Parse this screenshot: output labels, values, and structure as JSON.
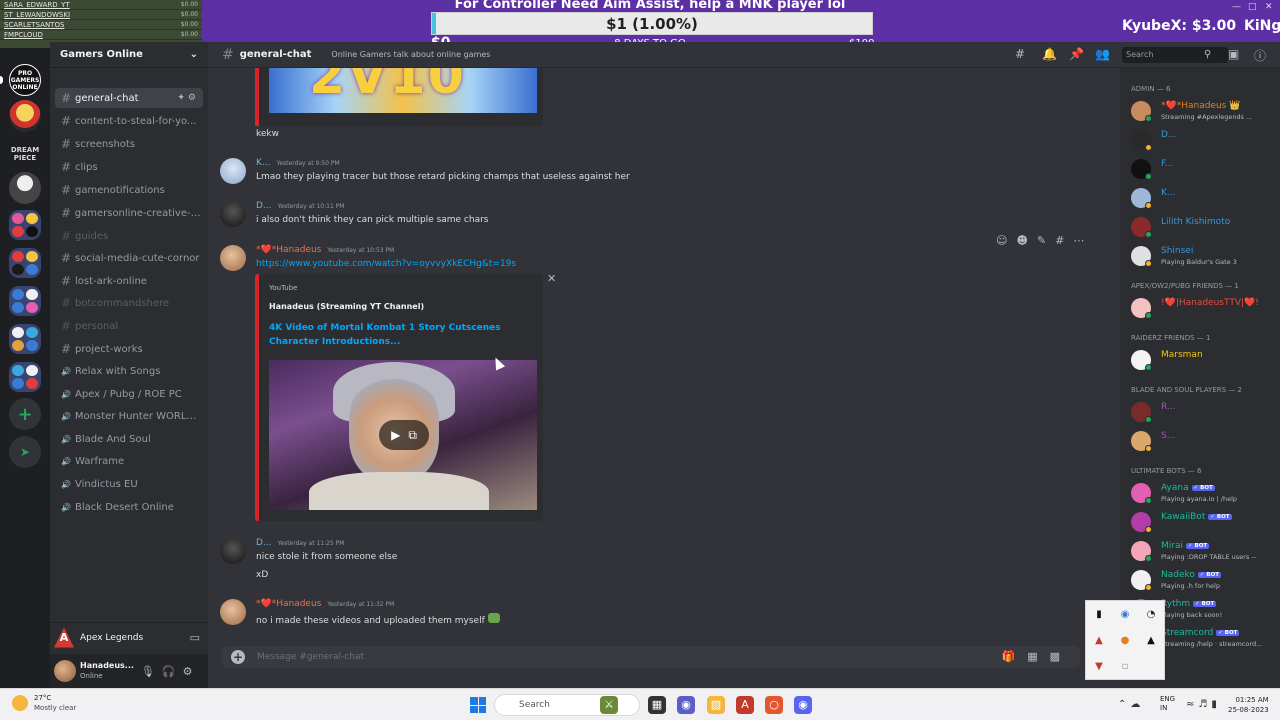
{
  "overlay": {
    "recent_list": [
      {
        "name": "SARA_EDWARD_YT",
        "count": "$0.00"
      },
      {
        "name": "ST_LEWANDOWSKI",
        "count": "$0.00"
      },
      {
        "name": "SCARLETSANTOS",
        "count": "$0.00"
      },
      {
        "name": "FMPCLOUD",
        "count": "$0.00"
      }
    ],
    "title": "For Controller Need Aim Assist, help a MNK player lol",
    "goal_text": "$1 (1.00%)",
    "goal_progress": 0.01,
    "goal_min": "$0",
    "goal_days": "8 DAYS TO GO",
    "goal_max": "$100",
    "top_donor": "KyubeX: $3.00",
    "ticker": "KiNg"
  },
  "servers": {
    "home_label": "PRO GAMERS ONLINE",
    "dream_label": "DREAM PIECE",
    "add_label": "+",
    "explore_label": "➤"
  },
  "sidebar": {
    "server_name": "Gamers Online",
    "channels": [
      {
        "label": "general-chat",
        "type": "text",
        "active": true
      },
      {
        "label": "content-to-steal-for-yo...",
        "type": "text"
      },
      {
        "label": "screenshots",
        "type": "text"
      },
      {
        "label": "clips",
        "type": "text"
      },
      {
        "label": "gamenotifications",
        "type": "text"
      },
      {
        "label": "gamersonline-creative-s...",
        "type": "text"
      },
      {
        "label": "guides",
        "type": "text",
        "muted": true
      },
      {
        "label": "social-media-cute-cornor",
        "type": "text"
      },
      {
        "label": "lost-ark-online",
        "type": "text"
      },
      {
        "label": "botcommandshere",
        "type": "text",
        "muted": true
      },
      {
        "label": "personal",
        "type": "text",
        "muted": true
      },
      {
        "label": "project-works",
        "type": "text"
      },
      {
        "label": "Relax with Songs",
        "type": "voice"
      },
      {
        "label": "Apex / Pubg / ROE PC",
        "type": "voice"
      },
      {
        "label": "Monster Hunter WORLD...",
        "type": "voice"
      },
      {
        "label": "Blade And Soul",
        "type": "voice"
      },
      {
        "label": "Warframe",
        "type": "voice"
      },
      {
        "label": "Vindictus EU",
        "type": "voice"
      },
      {
        "label": "Black Desert Online",
        "type": "voice"
      }
    ],
    "activity": "Apex Legends",
    "user": {
      "name": "Hanadeus...",
      "status": "Online"
    }
  },
  "header": {
    "channel": "general-chat",
    "topic": "Online Gamers talk about online games",
    "search_placeholder": "Search"
  },
  "messages": [
    {
      "text": "kekw"
    },
    {
      "author": "K...",
      "time": "Yesterday at 9:50 PM",
      "text": "Lmao they playing tracer but those retard picking champs that useless against her"
    },
    {
      "author": "D...",
      "time": "Yesterday at 10:11 PM",
      "text": "i also don't think they can pick multiple same chars"
    },
    {
      "author": "*❤️*Hanadeus",
      "time": "Yesterday at 10:53 PM",
      "text": "https://www.youtube.com/watch?v=oyvvyXkECHg&t=19s"
    },
    {
      "author": "D...",
      "time": "Yesterday at 11:25 PM",
      "text": "nice stole it from someone else",
      "text2": "xD"
    },
    {
      "author": "*❤️*Hanadeus",
      "time": "Yesterday at 11:32 PM",
      "text": "no i made these videos and uploaded them myself"
    }
  ],
  "embed": {
    "provider": "YouTube",
    "author": "Hanadeus (Streaming YT Channel)",
    "title": "4K Video of Mortal Kombat 1 Story Cutscenes Character Introductions...",
    "top_image_text": "2V10"
  },
  "composer": {
    "placeholder": "Message #general-chat"
  },
  "members": {
    "categories": [
      {
        "label": "ADMIN — 6",
        "items": [
          {
            "name": "*❤️*Hanadeus 👑",
            "sub": "Streaming #Apexlegends ...",
            "color": "#e67e22"
          },
          {
            "name": "D...",
            "sub": "",
            "color": "#3498db"
          },
          {
            "name": "F...",
            "sub": "",
            "color": "#3498db"
          },
          {
            "name": "K...",
            "sub": "",
            "color": "#3498db"
          },
          {
            "name": "Lilith Kishimoto",
            "sub": "",
            "color": "#3498db"
          },
          {
            "name": "Shinsei",
            "sub": "Playing Baldur's Gate 3",
            "color": "#3498db"
          }
        ]
      },
      {
        "label": "APEX/OW2/PUBG FRIENDS — 1",
        "items": [
          {
            "name": "!❤️|HanadeusTTV|❤️!",
            "sub": "",
            "color": "#e74c3c"
          }
        ]
      },
      {
        "label": "RAIDERZ FRIENDS — 1",
        "items": [
          {
            "name": "Marsman",
            "sub": "",
            "color": "#f1c40f"
          }
        ]
      },
      {
        "label": "BLADE AND SOUL PLAYERS — 2",
        "items": [
          {
            "name": "R...",
            "sub": "",
            "color": "#9b59b6"
          },
          {
            "name": "S...",
            "sub": "",
            "color": "#9b59b6"
          }
        ]
      },
      {
        "label": "ULTIMATE BOTS — 6",
        "items": [
          {
            "name": "Ayana",
            "sub": "Playing ayana.io | /help",
            "color": "#1abc9c",
            "bot": true
          },
          {
            "name": "KawaiiBot",
            "sub": "",
            "color": "#1abc9c",
            "bot": true
          },
          {
            "name": "Mirai",
            "sub": "Playing :DROP TABLE users --",
            "color": "#1abc9c",
            "bot": true
          },
          {
            "name": "Nadeko",
            "sub": "Playing .h for help",
            "color": "#1abc9c",
            "bot": true
          },
          {
            "name": "Rythm",
            "sub": "Playing back soon!",
            "color": "#1abc9c",
            "bot": true
          },
          {
            "name": "Streamcord",
            "sub": "Streaming /help · streamcord...",
            "color": "#1abc9c",
            "bot": true
          }
        ]
      }
    ],
    "bot_label": "✓ BOT"
  },
  "taskbar": {
    "temp": "27°C",
    "weather": "Mostly clear",
    "search": "Search",
    "lang1": "ENG",
    "lang2": "IN",
    "time": "01:25 AM",
    "date": "25-08-2023"
  },
  "colors": {
    "accent_overlay": "#5d2fa5",
    "link": "#00a8fc",
    "online": "#23a55a",
    "idle": "#f0b232",
    "youtube_red": "#d7262b"
  }
}
